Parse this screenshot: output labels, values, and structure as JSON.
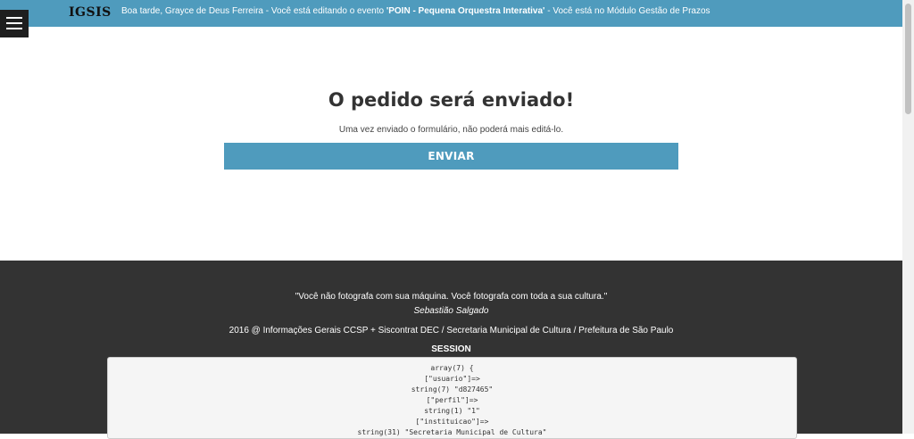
{
  "topbar": {
    "brand": "IGSIS",
    "greeting": "Boa tarde, Grayce de Deus Ferreira - Você está editando o evento ",
    "event_name": "'POIN - Pequena Orquestra Interativa'",
    "module_msg": " - Você está no Módulo Gestão de Prazos"
  },
  "main": {
    "heading": "O pedido será enviado!",
    "subtext": "Uma vez enviado o formulário, não poderá mais editá-lo.",
    "send_label": "ENVIAR"
  },
  "footer": {
    "quote": "\"Você não fotografa com sua máquina. Você fotografa com toda a sua cultura.\"",
    "author": "Sebastião Salgado",
    "copyright": "2016 @ Informações Gerais CCSP + Siscontrat DEC / Secretaria Municipal de Cultura / Prefeitura de São Paulo",
    "session_label": "SESSION",
    "session_lines": [
      "array(7) {",
      "[\"usuario\"]=>",
      "string(7) \"d827465\"",
      "[\"perfil\"]=>",
      "string(1) \"1\"",
      "[\"instituicao\"]=>",
      "string(31) \"Secretaria Municipal de Cultura\""
    ]
  },
  "colors": {
    "accent": "#4f9bbd",
    "footer_bg": "#333333",
    "menu_bg": "#1e1e1e"
  },
  "icons": {
    "menu": "hamburger-menu-icon"
  }
}
